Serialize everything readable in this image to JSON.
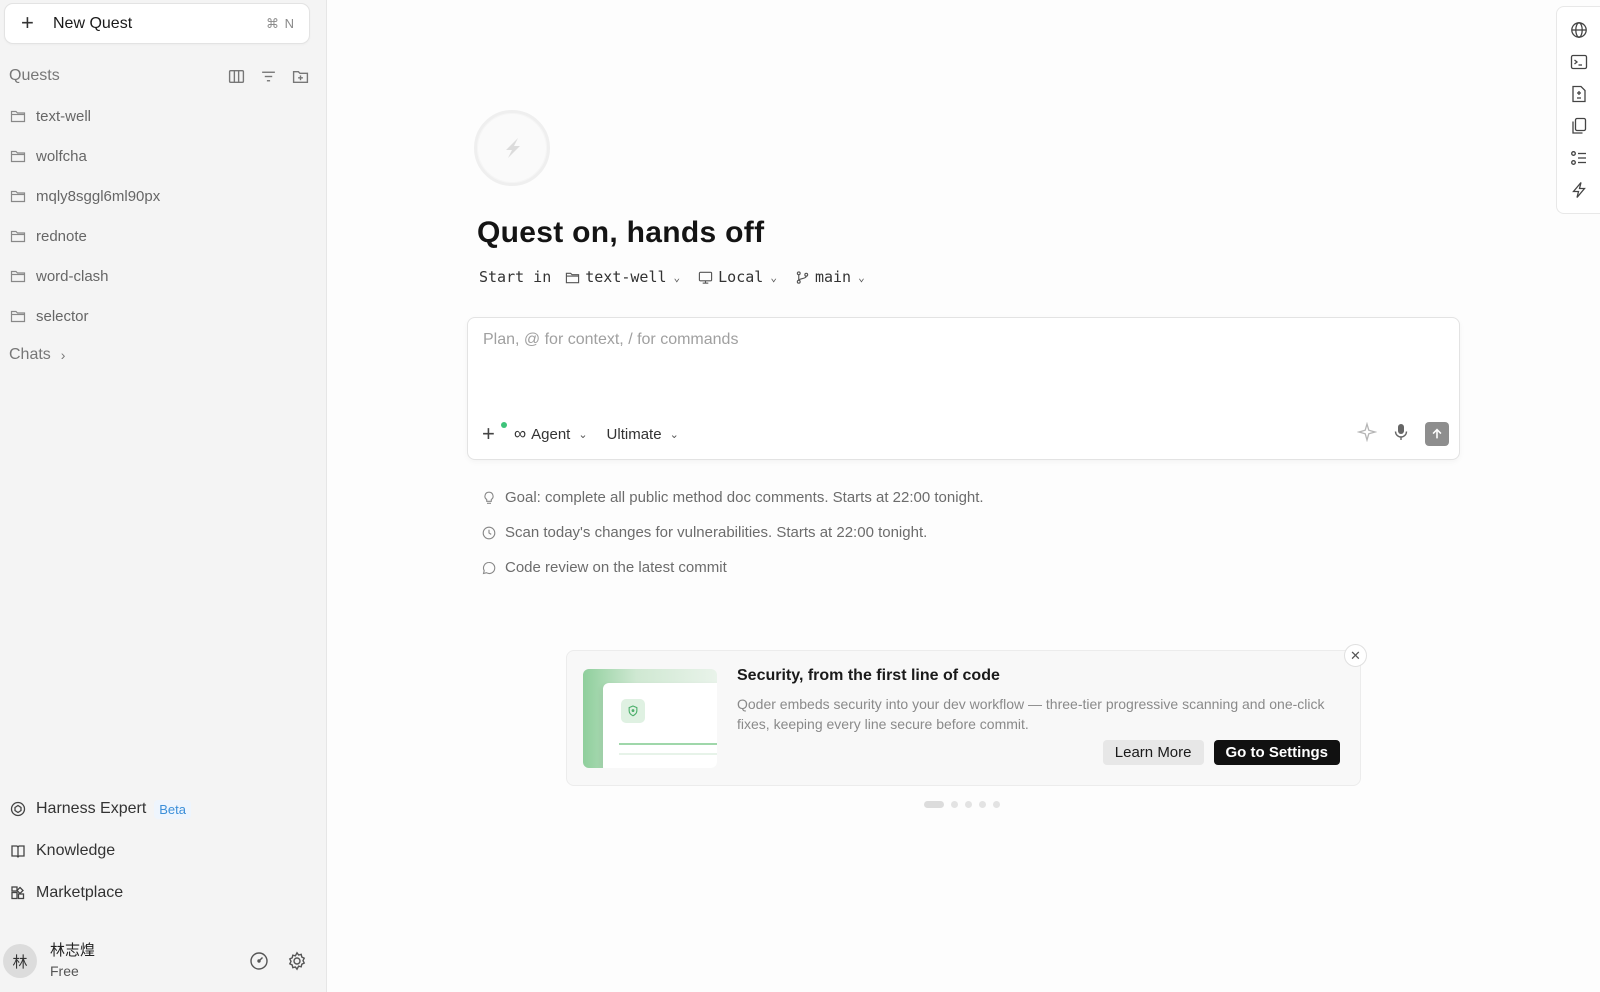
{
  "sidebar": {
    "new_quest_label": "New Quest",
    "new_quest_shortcut": "⌘ N",
    "quests_title": "Quests",
    "quests": [
      {
        "name": "text-well"
      },
      {
        "name": "wolfcha"
      },
      {
        "name": "mqly8sggl6ml90px"
      },
      {
        "name": "rednote"
      },
      {
        "name": "word-clash"
      },
      {
        "name": "selector"
      }
    ],
    "chats_title": "Chats",
    "bottom_nav": [
      {
        "label": "Harness Expert",
        "badge": "Beta"
      },
      {
        "label": "Knowledge"
      },
      {
        "label": "Marketplace"
      }
    ],
    "user": {
      "avatar_text": "林",
      "name": "林志煌",
      "plan": "Free"
    }
  },
  "main": {
    "title": "Quest on, hands off",
    "start_in_label": "Start in",
    "project": "text-well",
    "environment": "Local",
    "branch": "main",
    "composer": {
      "placeholder": "Plan, @ for context, / for commands",
      "mode": "Agent",
      "model": "Ultimate"
    },
    "suggestions": [
      {
        "icon": "lightbulb-icon",
        "text": "Goal: complete all public method doc comments. Starts at 22:00 tonight."
      },
      {
        "icon": "clock-icon",
        "text": "Scan today's changes for vulnerabilities. Starts at 22:00 tonight."
      },
      {
        "icon": "comment-icon",
        "text": "Code review on the latest commit"
      }
    ],
    "promo": {
      "title": "Security, from the first line of code",
      "description": "Qoder embeds security into your dev workflow — three-tier progressive scanning and one-click fixes, keeping every line secure before commit.",
      "learn_more": "Learn More",
      "go_settings": "Go to Settings",
      "page_count": 5,
      "active_page": 1
    }
  },
  "colors": {
    "accent_green": "#3ec37a",
    "badge_blue": "#3b8fd9",
    "primary_button": "#111111"
  }
}
